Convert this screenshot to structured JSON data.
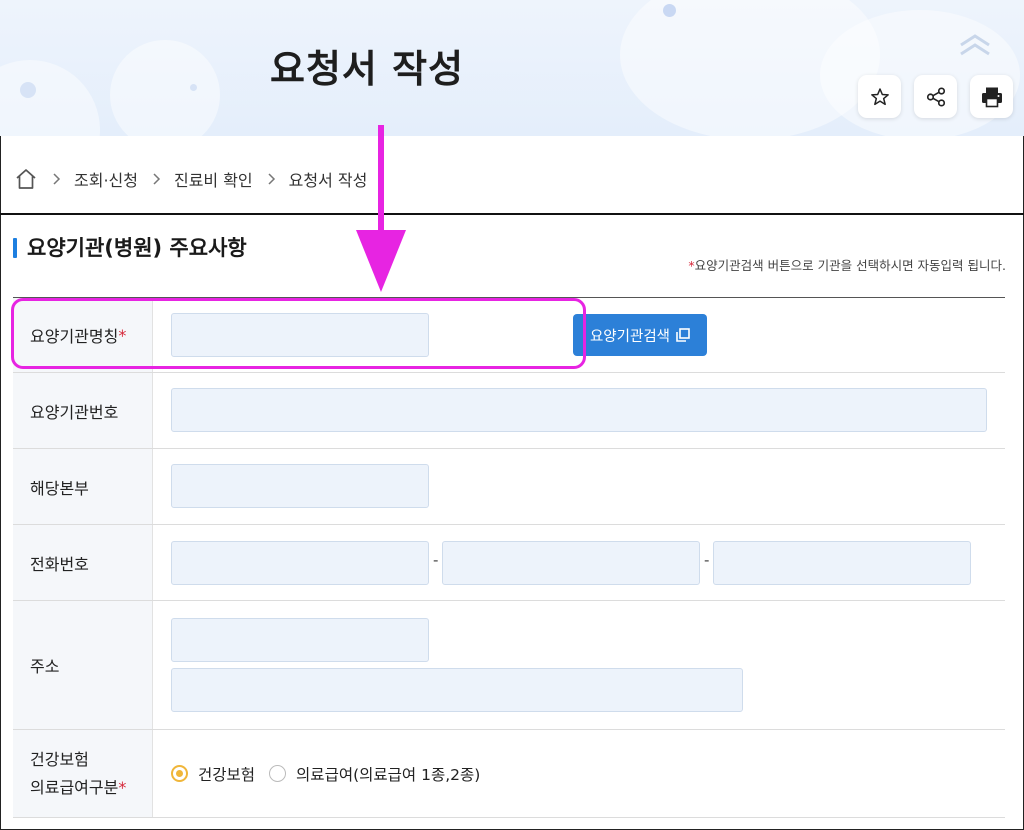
{
  "header": {
    "title": "요청서 작성",
    "colors": {
      "banner": "#e6effb"
    }
  },
  "toolbar": {
    "icons": [
      "star-icon",
      "share-icon",
      "print-icon"
    ]
  },
  "breadcrumb": {
    "items": [
      "조회·신청",
      "진료비 확인",
      "요청서 작성"
    ]
  },
  "section": {
    "title": "요양기관(병원) 주요사항",
    "note_star": "*",
    "note": "요양기관검색 버튼으로 기관을 선택하시면 자동입력 됩니다."
  },
  "form": {
    "institution_name": {
      "label": "요양기관명칭",
      "required": "*",
      "value": ""
    },
    "search_button": {
      "label": "요양기관검색"
    },
    "institution_number": {
      "label": "요양기관번호",
      "value": ""
    },
    "branch": {
      "label": "해당본부",
      "value": ""
    },
    "phone": {
      "label": "전화번호",
      "separator": "-"
    },
    "address": {
      "label": "주소"
    },
    "insurance_type": {
      "label_line1": "건강보험",
      "label_line2": "의료급여구분",
      "required": "*",
      "options": [
        "건강보험",
        "의료급여(의료급여 1종,2종)"
      ],
      "selected": "건강보험"
    }
  },
  "colors": {
    "accent": "#2c80d8",
    "required": "#d6283a",
    "radio_selected": "#f0b63a",
    "annotation": "#e724e2"
  }
}
